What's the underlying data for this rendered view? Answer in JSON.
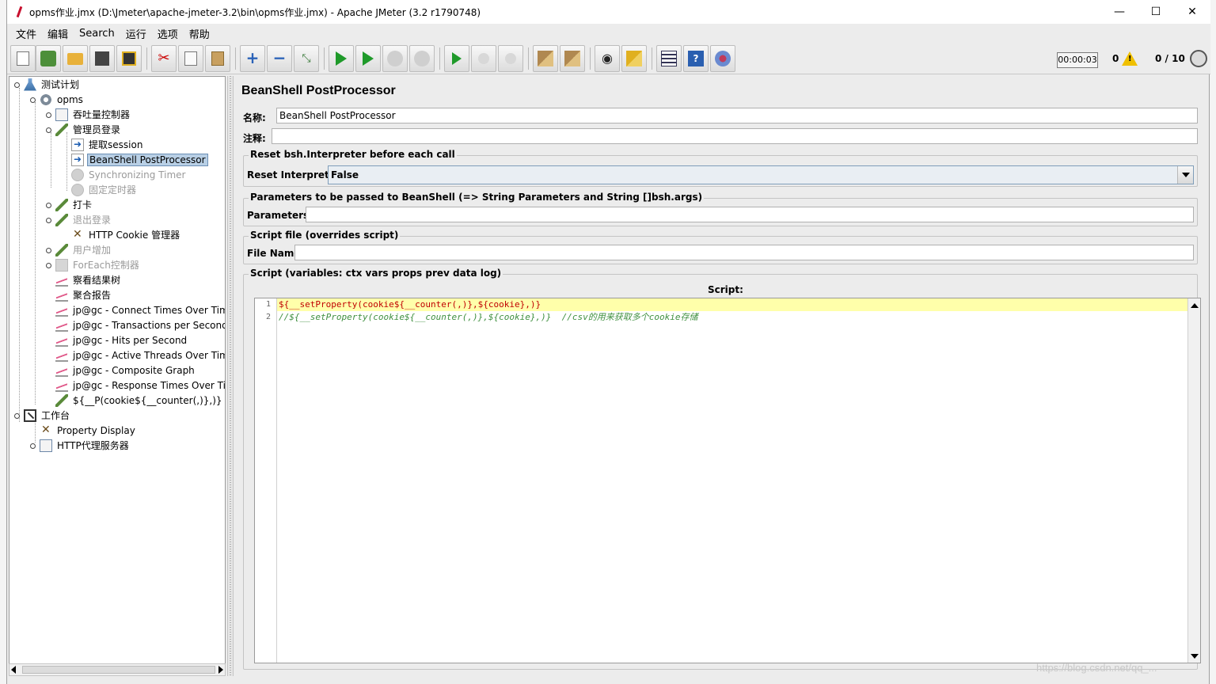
{
  "window": {
    "title": "opms作业.jmx (D:\\Jmeter\\apache-jmeter-3.2\\bin\\opms作业.jmx) - Apache JMeter (3.2 r1790748)",
    "minimize": "—",
    "maximize": "☐",
    "close": "✕"
  },
  "menu": [
    "文件",
    "编辑",
    "Search",
    "运行",
    "选项",
    "帮助"
  ],
  "toolbar": {
    "timer": "00:00:03",
    "warnings": "0",
    "threads": "0 / 10"
  },
  "tree": [
    {
      "label": "测试计划",
      "icon": "flask-icon"
    },
    {
      "label": "opms",
      "icon": "gear-icon"
    },
    {
      "label": "吞吐量控制器",
      "icon": "controller-icon"
    },
    {
      "label": "管理员登录",
      "icon": "sampler-icon"
    },
    {
      "label": "提取session",
      "icon": "postprocessor-icon"
    },
    {
      "label": "BeanShell PostProcessor",
      "icon": "postprocessor-icon",
      "selected": true
    },
    {
      "label": "Synchronizing Timer",
      "icon": "timer-icon",
      "disabled": true
    },
    {
      "label": "固定定时器",
      "icon": "timer-icon",
      "disabled": true
    },
    {
      "label": "打卡",
      "icon": "sampler-icon"
    },
    {
      "label": "退出登录",
      "icon": "sampler-icon",
      "disabled": true
    },
    {
      "label": "HTTP Cookie 管理器",
      "icon": "config-tools-icon"
    },
    {
      "label": "用户增加",
      "icon": "sampler-icon",
      "disabled": true
    },
    {
      "label": "ForEach控制器",
      "icon": "foreach-icon",
      "disabled": true
    },
    {
      "label": "察看结果树",
      "icon": "listener-chart-icon"
    },
    {
      "label": "聚合报告",
      "icon": "listener-chart-icon"
    },
    {
      "label": "jp@gc - Connect Times Over Time",
      "icon": "listener-chart-icon"
    },
    {
      "label": "jp@gc - Transactions per Second",
      "icon": "listener-chart-icon"
    },
    {
      "label": "jp@gc - Hits per Second",
      "icon": "listener-chart-icon"
    },
    {
      "label": "jp@gc - Active Threads Over Time",
      "icon": "listener-chart-icon"
    },
    {
      "label": "jp@gc - Composite Graph",
      "icon": "listener-chart-icon"
    },
    {
      "label": "jp@gc - Response Times Over Tin",
      "icon": "listener-chart-icon"
    },
    {
      "label": "${__P(cookie${__counter(,)},)}",
      "icon": "sampler-icon"
    },
    {
      "label": "工作台",
      "icon": "workbench-icon"
    },
    {
      "label": "Property Display",
      "icon": "config-tools-icon"
    },
    {
      "label": "HTTP代理服务器",
      "icon": "controller-icon"
    }
  ],
  "panel": {
    "title": "BeanShell PostProcessor",
    "name_label": "名称:",
    "name_value": "BeanShell PostProcessor",
    "comment_label": "注释:",
    "comment_value": "",
    "reset_group": "Reset bsh.Interpreter before each call",
    "reset_label": "Reset Interpreter:",
    "reset_value": "False",
    "params_group": "Parameters to be passed to BeanShell (=> String Parameters and String []bsh.args)",
    "params_label": "Parameters:",
    "params_value": "",
    "file_group": "Script file (overrides script)",
    "file_label": "File Name:",
    "file_value": "",
    "script_group": "Script (variables: ctx vars props prev data log)",
    "script_label": "Script:",
    "script_lines": [
      "${__setProperty(cookie${__counter(,)},${cookie},)}",
      "//${__setProperty(cookie${__counter(,)},${cookie},)}  //csv的用来获取多个cookie存储"
    ],
    "line_numbers": [
      "1",
      "2"
    ]
  },
  "watermark": "https://blog.csdn.net/qq_..."
}
